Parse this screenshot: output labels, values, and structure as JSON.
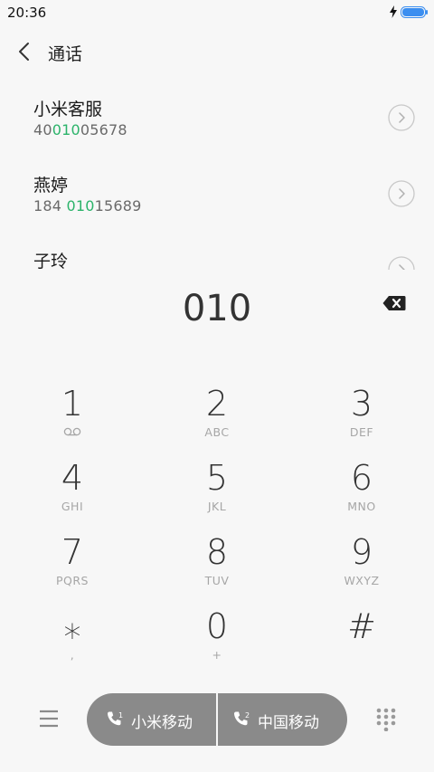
{
  "status_bar": {
    "time": "20:36",
    "battery_icon": "battery-charging-icon",
    "accent": "#3b8ef0"
  },
  "header": {
    "title": "通话",
    "back_icon": "chevron-left-icon"
  },
  "results": [
    {
      "name": "小米客服",
      "number_pre": "40",
      "number_match": "010",
      "number_post": "05678"
    },
    {
      "name": "燕婷",
      "number_pre": "184 ",
      "number_match": "010",
      "number_post": "15689"
    },
    {
      "name": "子玲",
      "number_pre": "",
      "number_match": "",
      "number_post": ""
    }
  ],
  "dial_input": {
    "value": "010",
    "backspace_icon": "backspace-icon"
  },
  "keypad": [
    {
      "digit": "1",
      "letters": "",
      "icon": "voicemail-icon"
    },
    {
      "digit": "2",
      "letters": "ABC"
    },
    {
      "digit": "3",
      "letters": "DEF"
    },
    {
      "digit": "4",
      "letters": "GHI"
    },
    {
      "digit": "5",
      "letters": "JKL"
    },
    {
      "digit": "6",
      "letters": "MNO"
    },
    {
      "digit": "7",
      "letters": "PQRS"
    },
    {
      "digit": "8",
      "letters": "TUV"
    },
    {
      "digit": "9",
      "letters": "WXYZ"
    },
    {
      "digit": "⁎",
      "letters": ","
    },
    {
      "digit": "0",
      "letters": "+"
    },
    {
      "digit": "#",
      "letters": ""
    }
  ],
  "bottom_bar": {
    "menu_icon": "menu-icon",
    "sim1": {
      "label": "小米移动",
      "sim_number": "1"
    },
    "sim2": {
      "label": "中国移动",
      "sim_number": "2"
    },
    "dialpad_icon": "dialpad-icon",
    "highlight_color": "#2bb36a"
  }
}
